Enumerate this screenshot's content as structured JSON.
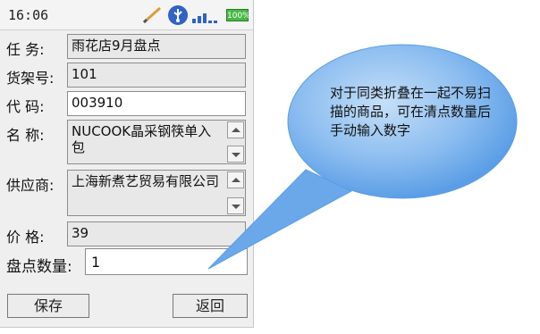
{
  "status_bar": {
    "time": "16:06",
    "battery_label": "100%",
    "icons": [
      "pencil-icon",
      "usb-icon",
      "signal-icon",
      "battery-icon"
    ]
  },
  "form": {
    "task_label": "任  务:",
    "task_value": "雨花店9月盘点",
    "shelf_label": "货架号:",
    "shelf_value": "101",
    "code_label": "代  码:",
    "code_value": "003910",
    "name_label": "名  称:",
    "name_value": "NUCOOK晶采钢筷单入包",
    "supplier_label": "供应商:",
    "supplier_value": "上海新煮艺贸易有限公司",
    "price_label": "价  格:",
    "price_value": "39",
    "qty_label": "盘点数量:",
    "qty_value": "1"
  },
  "buttons": {
    "save_label": "保存",
    "back_label": "返回"
  },
  "callout": {
    "text": "对于同类折叠在一起不易扫描的商品，可在清点数量后手动输入数字"
  },
  "colors": {
    "callout_fill": "#5b9ee6",
    "callout_light": "#c5dff8",
    "battery": "#46b946"
  }
}
